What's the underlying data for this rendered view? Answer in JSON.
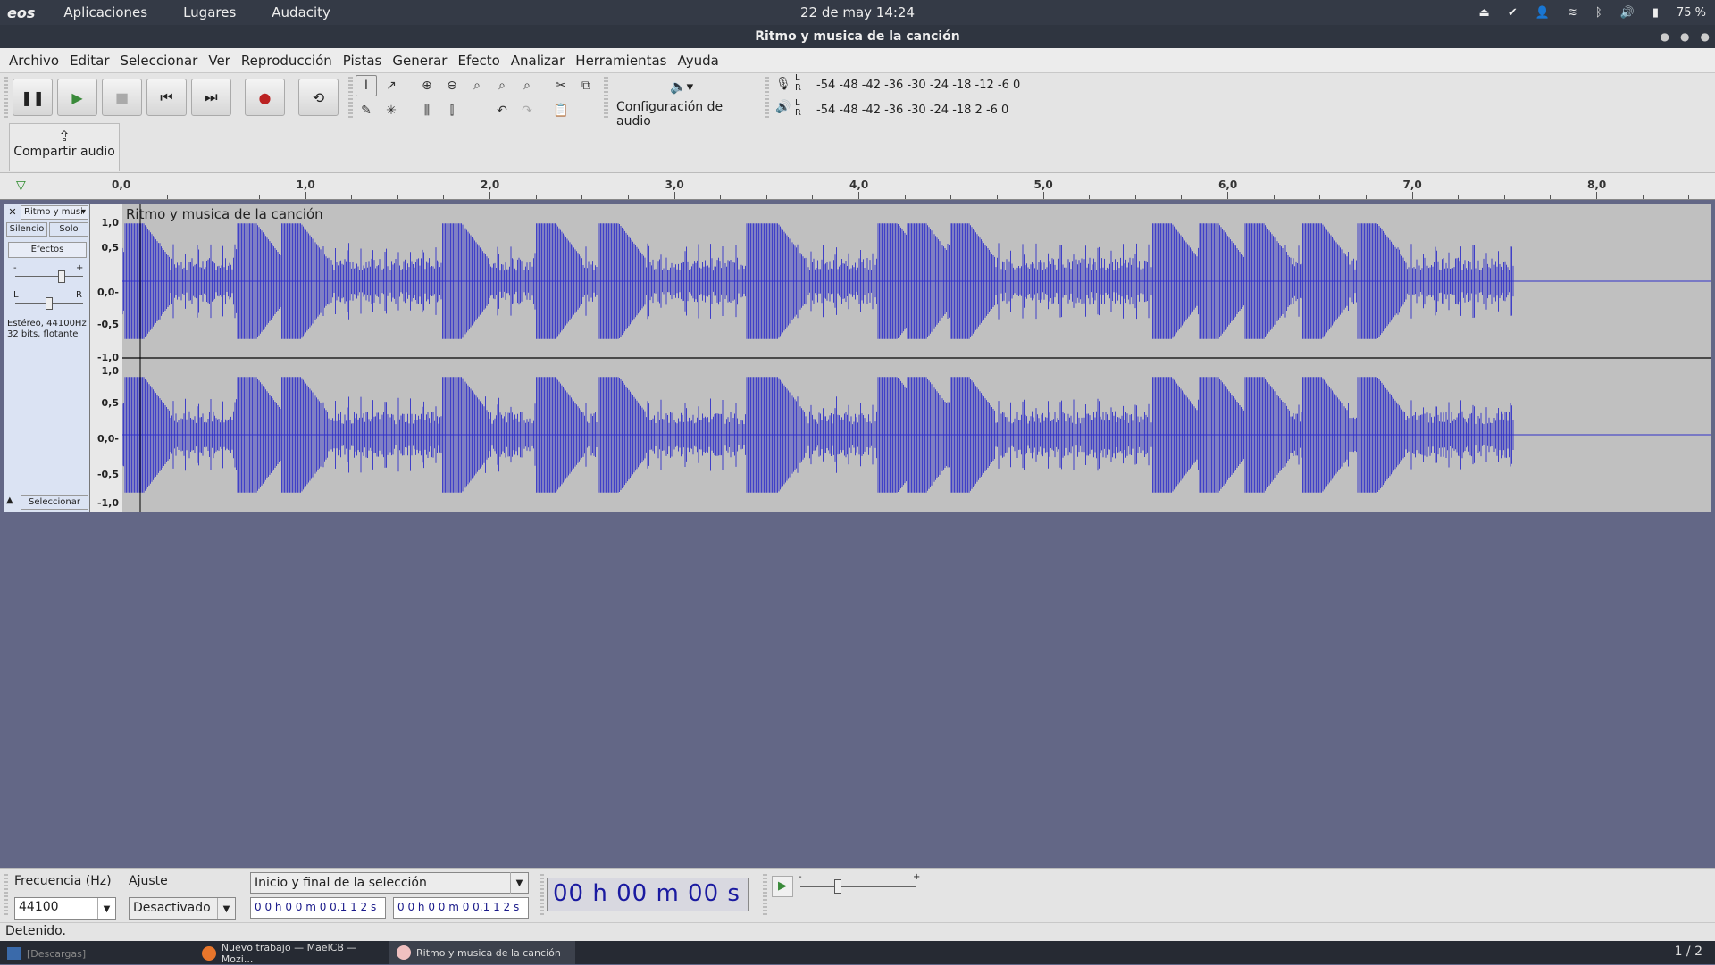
{
  "topbar": {
    "logo": "eos",
    "menus": [
      "Aplicaciones",
      "Lugares",
      "Audacity"
    ],
    "datetime": "22 de may  14:24",
    "battery": "75 %"
  },
  "window_title": "Ritmo y musica de la canción",
  "menubar": [
    "Archivo",
    "Editar",
    "Seleccionar",
    "Ver",
    "Reproducción",
    "Pistas",
    "Generar",
    "Efecto",
    "Analizar",
    "Herramientas",
    "Ayuda"
  ],
  "toolbar": {
    "audio_config_label": "Configuración de audio",
    "share_label": "Compartir audio",
    "meter_rec_scale": "-54 -48 -42 -36 -30 -24 -18 -12  -6  0",
    "meter_play_scale": "-54 -48 -42 -36 -30 -24 -18  2  -6  0",
    "lr_L": "L",
    "lr_R": "R"
  },
  "ruler": {
    "ticks": [
      "0,0",
      "1,0",
      "2,0",
      "3,0",
      "4,0",
      "5,0",
      "6,0",
      "7,0",
      "8,0"
    ]
  },
  "track": {
    "name": "Ritmo y musi",
    "clip_title": "Ritmo y musica de la canción",
    "mute": "Silencio",
    "solo": "Solo",
    "effects": "Efectos",
    "gain_minus": "-",
    "gain_plus": "+",
    "pan_l": "L",
    "pan_r": "R",
    "info_line1": "Estéreo, 44100Hz",
    "info_line2": "32 bits, flotante",
    "select": "Seleccionar",
    "scale": [
      "1,0",
      "0,5",
      "0,0-",
      "-0,5",
      "-1,0",
      "1,0",
      "0,5",
      "0,0-",
      "-0,5",
      "-1,0"
    ]
  },
  "bottom": {
    "rate_label": "Frecuencia (Hz)",
    "rate_value": "44100",
    "snap_label": "Ajuste",
    "snap_value": "Desactivado",
    "selection_mode": "Inicio y final de la selección",
    "sel_start": "0 0 h 0 0 m 0 0.1 1 2 s",
    "sel_end": "0 0 h 0 0 m 0 0.1 1 2 s",
    "time_display": "00 h 00 m 00 s",
    "speed_minus": "-",
    "speed_plus": "+",
    "status": "Detenido."
  },
  "taskbar": {
    "items": [
      "[Descargas]",
      "Nuevo trabajo — MaelCB — Mozi...",
      "Ritmo y musica de la canción"
    ],
    "workspace": "1 / 2"
  },
  "colors": {
    "waveform": "#3232c8",
    "track_bg": "#c0c0c0",
    "desktop": "#636786"
  }
}
